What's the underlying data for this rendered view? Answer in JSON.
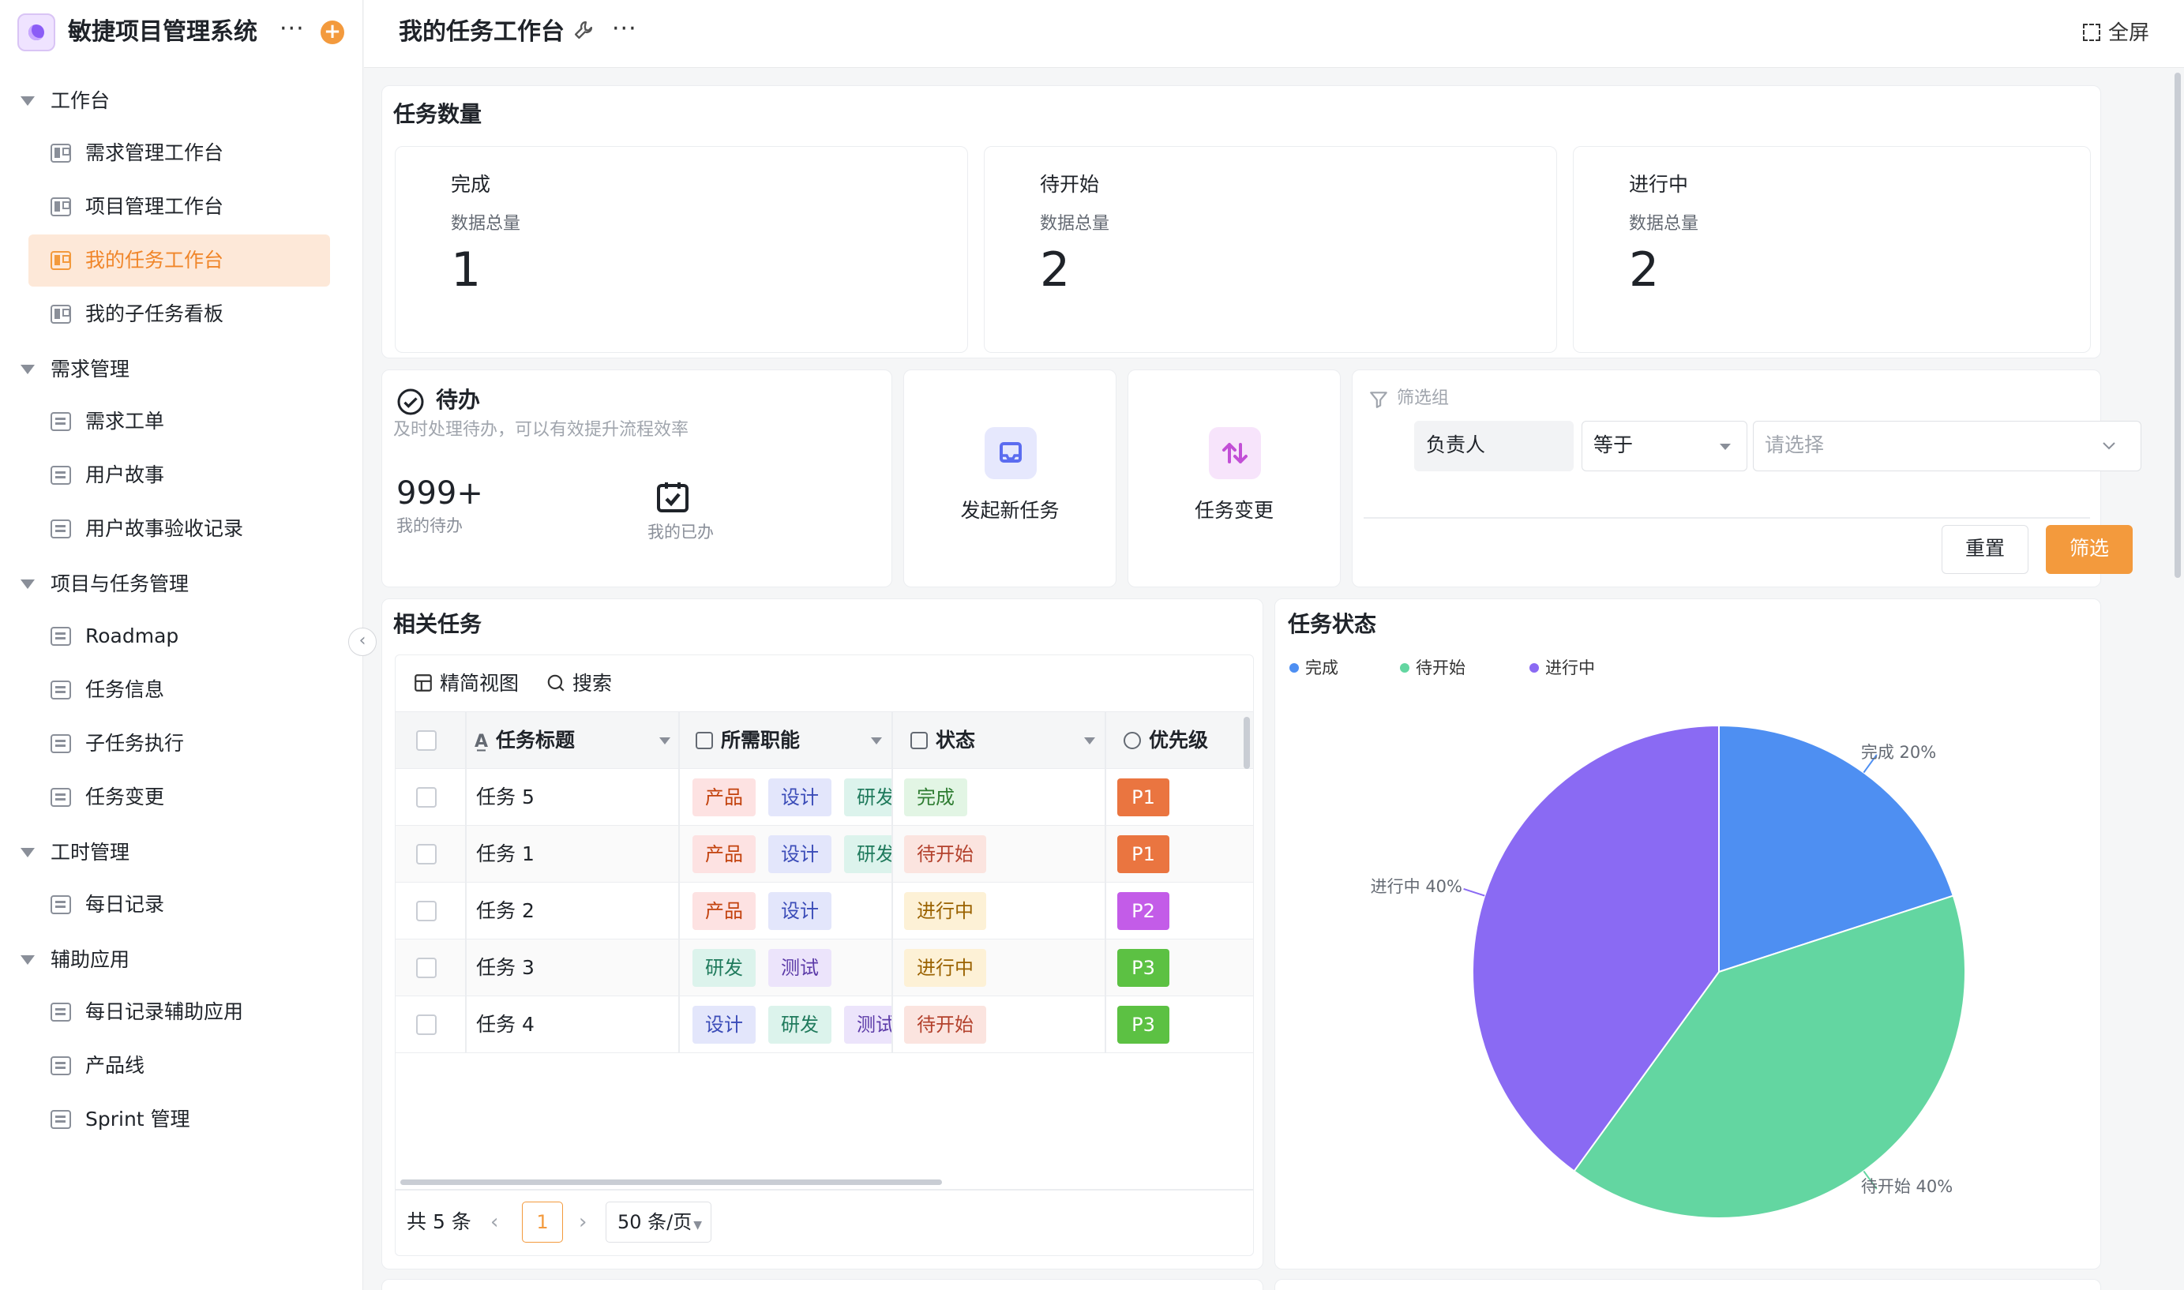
{
  "app": {
    "title": "敏捷项目管理系统"
  },
  "sidebar": {
    "groups": [
      {
        "label": "工作台",
        "items": [
          {
            "label": "需求管理工作台",
            "icon": "board-icon"
          },
          {
            "label": "项目管理工作台",
            "icon": "board-icon"
          },
          {
            "label": "我的任务工作台",
            "icon": "board-icon",
            "active": true
          },
          {
            "label": "我的子任务看板",
            "icon": "board-icon"
          }
        ]
      },
      {
        "label": "需求管理",
        "items": [
          {
            "label": "需求工单",
            "icon": "doc-icon"
          },
          {
            "label": "用户故事",
            "icon": "doc-icon"
          },
          {
            "label": "用户故事验收记录",
            "icon": "doc-icon"
          }
        ]
      },
      {
        "label": "项目与任务管理",
        "items": [
          {
            "label": "Roadmap",
            "icon": "doc-icon"
          },
          {
            "label": "任务信息",
            "icon": "doc-icon"
          },
          {
            "label": "子任务执行",
            "icon": "doc-icon"
          },
          {
            "label": "任务变更",
            "icon": "doc-icon"
          }
        ]
      },
      {
        "label": "工时管理",
        "items": [
          {
            "label": "每日记录",
            "icon": "doc-icon"
          }
        ]
      },
      {
        "label": "辅助应用",
        "items": [
          {
            "label": "每日记录辅助应用",
            "icon": "doc-icon"
          },
          {
            "label": "产品线",
            "icon": "doc-icon"
          },
          {
            "label": "Sprint 管理",
            "icon": "doc-icon"
          }
        ]
      }
    ]
  },
  "topbar": {
    "title": "我的任务工作台",
    "fullscreen_label": "全屏"
  },
  "task_count": {
    "title": "任务数量",
    "stats": [
      {
        "label": "完成",
        "sublabel": "数据总量",
        "value": "1"
      },
      {
        "label": "待开始",
        "sublabel": "数据总量",
        "value": "2"
      },
      {
        "label": "进行中",
        "sublabel": "数据总量",
        "value": "2"
      }
    ]
  },
  "todo": {
    "title": "待办",
    "subtitle": "及时处理待办，可以有效提升流程效率",
    "pending_value": "999+",
    "pending_label": "我的待办",
    "done_label": "我的已办"
  },
  "actions": [
    {
      "label": "发起新任务",
      "icon": "inbox-icon",
      "color": "#6b7cf6"
    },
    {
      "label": "任务变更",
      "icon": "swap-icon",
      "color": "#c85ad8"
    }
  ],
  "filter": {
    "group_label": "筛选组",
    "field": "负责人",
    "operator": "等于",
    "value_placeholder": "请选择",
    "reset_label": "重置",
    "submit_label": "筛选"
  },
  "related_tasks": {
    "title": "相关任务",
    "toolbar": {
      "view_label": "精简视图",
      "search_label": "搜索"
    },
    "columns": [
      "任务标题",
      "所需职能",
      "状态",
      "优先级"
    ],
    "rows": [
      {
        "title": "任务 5",
        "functions": [
          "产品",
          "设计",
          "研发"
        ],
        "status": "完成",
        "priority": "P1"
      },
      {
        "title": "任务 1",
        "functions": [
          "产品",
          "设计",
          "研发"
        ],
        "status": "待开始",
        "priority": "P1"
      },
      {
        "title": "任务 2",
        "functions": [
          "产品",
          "设计"
        ],
        "status": "进行中",
        "priority": "P2"
      },
      {
        "title": "任务 3",
        "functions": [
          "研发",
          "测试"
        ],
        "status": "进行中",
        "priority": "P3"
      },
      {
        "title": "任务 4",
        "functions": [
          "设计",
          "研发",
          "测试"
        ],
        "status": "待开始",
        "priority": "P3"
      }
    ],
    "pagination": {
      "total_label": "共 5 条",
      "current_page": "1",
      "page_size": "50 条/页"
    }
  },
  "colors": {
    "accent": "#f39a3d",
    "priority": {
      "P1": "#ea7540",
      "P2": "#c35ce8",
      "P3": "#5cc143"
    }
  },
  "task_status": {
    "title": "任务状态",
    "chart_data": {
      "type": "pie",
      "title": "任务状态",
      "slices": [
        {
          "name": "完成",
          "value": 20,
          "label": "完成 20%",
          "color": "#4e8ff2"
        },
        {
          "name": "待开始",
          "value": 40,
          "label": "待开始 40%",
          "color": "#63d6a1"
        },
        {
          "name": "进行中",
          "value": 40,
          "label": "进行中 40%",
          "color": "#8a6af3"
        }
      ],
      "legend_position": "top-left"
    }
  }
}
